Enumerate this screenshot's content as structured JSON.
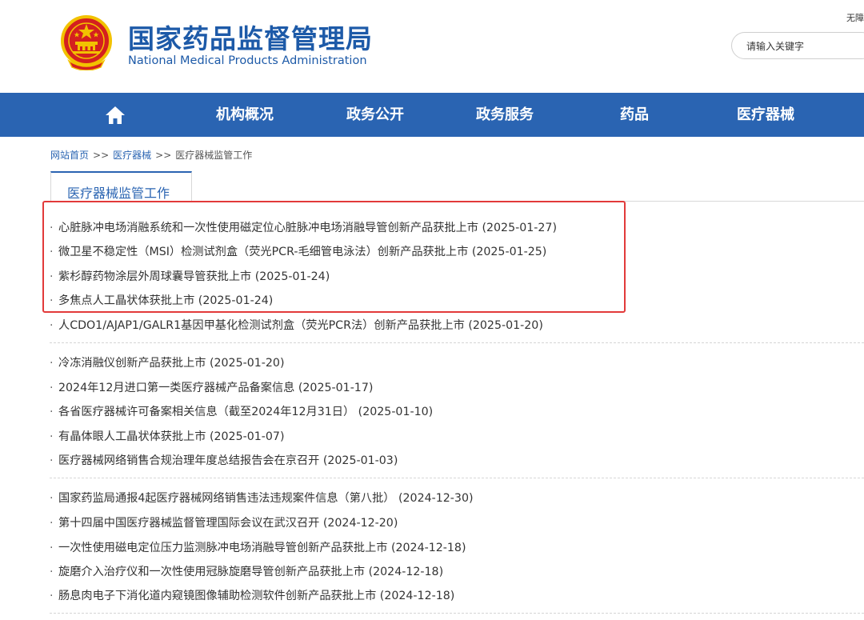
{
  "header": {
    "title_cn": "国家药品监督管理局",
    "title_en": "National Medical Products Administration",
    "top_right_link": "无障",
    "search_placeholder": "请输入关键字"
  },
  "nav": {
    "items": [
      {
        "label": "机构概况"
      },
      {
        "label": "政务公开"
      },
      {
        "label": "政务服务"
      },
      {
        "label": "药品"
      },
      {
        "label": "医疗器械"
      }
    ]
  },
  "breadcrumb": {
    "home": "网站首页",
    "sep1": ">>",
    "category": "医疗器械",
    "sep2": ">>",
    "current": "医疗器械监管工作"
  },
  "section_tab": "医疗器械监管工作",
  "news": [
    {
      "title": "心脏脉冲电场消融系统和一次性使用磁定位心脏脉冲电场消融导管创新产品获批上市",
      "date": "(2025-01-27)"
    },
    {
      "title": "微卫星不稳定性（MSI）检测试剂盒（荧光PCR-毛细管电泳法）创新产品获批上市",
      "date": "(2025-01-25)"
    },
    {
      "title": "紫杉醇药物涂层外周球囊导管获批上市",
      "date": "(2025-01-24)"
    },
    {
      "title": "多焦点人工晶状体获批上市",
      "date": "(2025-01-24)"
    },
    {
      "title": "人CDO1/AJAP1/GALR1基因甲基化检测试剂盒（荧光PCR法）创新产品获批上市",
      "date": "(2025-01-20)"
    },
    {
      "title": "冷冻消融仪创新产品获批上市",
      "date": "(2025-01-20)"
    },
    {
      "title": "2024年12月进口第一类医疗器械产品备案信息",
      "date": "(2025-01-17)"
    },
    {
      "title": "各省医疗器械许可备案相关信息（截至2024年12月31日）",
      "date": "(2025-01-10)"
    },
    {
      "title": "有晶体眼人工晶状体获批上市",
      "date": "(2025-01-07)"
    },
    {
      "title": "医疗器械网络销售合规治理年度总结报告会在京召开",
      "date": "(2025-01-03)"
    },
    {
      "title": "国家药监局通报4起医疗器械网络销售违法违规案件信息（第八批）",
      "date": "(2024-12-30)"
    },
    {
      "title": "第十四届中国医疗器械监督管理国际会议在武汉召开",
      "date": "(2024-12-20)"
    },
    {
      "title": "一次性使用磁电定位压力监测脉冲电场消融导管创新产品获批上市",
      "date": "(2024-12-18)"
    },
    {
      "title": "旋磨介入治疗仪和一次性使用冠脉旋磨导管创新产品获批上市",
      "date": "(2024-12-18)"
    },
    {
      "title": "肠息肉电子下消化道内窥镜图像辅助检测软件创新产品获批上市",
      "date": "(2024-12-18)"
    }
  ],
  "colors": {
    "brand_blue": "#2a64b2",
    "title_blue": "#1d5aa8",
    "highlight_red": "#e23a3a",
    "emblem_red": "#d4201f",
    "emblem_gold": "#f2c200"
  }
}
